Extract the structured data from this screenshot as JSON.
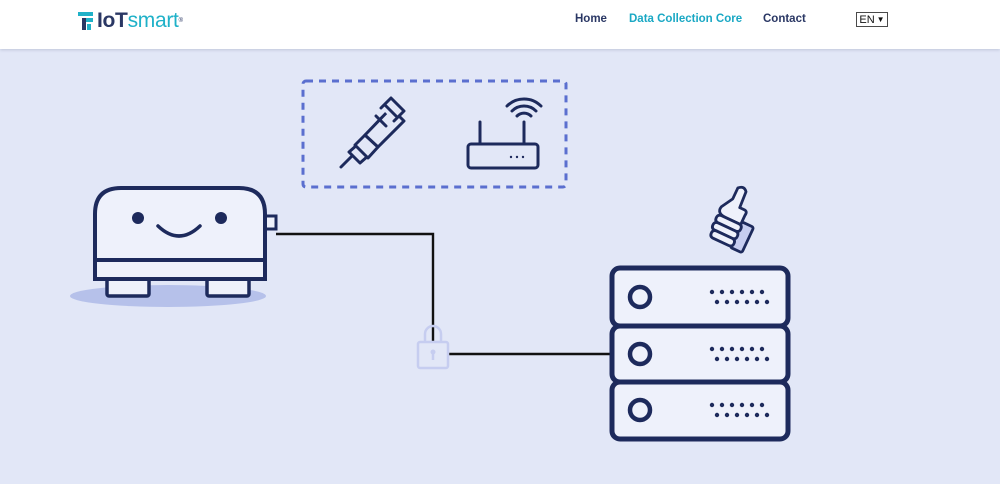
{
  "header": {
    "logo": {
      "prefix": "IoT",
      "accent": "smart",
      "mark": "®"
    },
    "nav": [
      {
        "label": "Home",
        "active": false
      },
      {
        "label": "Data Collection Core",
        "active": true
      },
      {
        "label": "Contact",
        "active": false
      }
    ],
    "language": {
      "selected": "EN"
    }
  },
  "illustration": {
    "icons": [
      "ethernet-plug-icon",
      "wifi-router-icon",
      "smiling-device-icon",
      "lock-icon",
      "thumbs-up-icon",
      "server-rack-icon"
    ]
  },
  "colors": {
    "background": "#e2e7f7",
    "navy": "#1d2a5c",
    "accent": "#1aa8c4",
    "dashed_box": "#5b6fcf",
    "device_fill": "#eef1fb",
    "shadow": "#b6c1ea",
    "lock": "#c6cdf0"
  }
}
